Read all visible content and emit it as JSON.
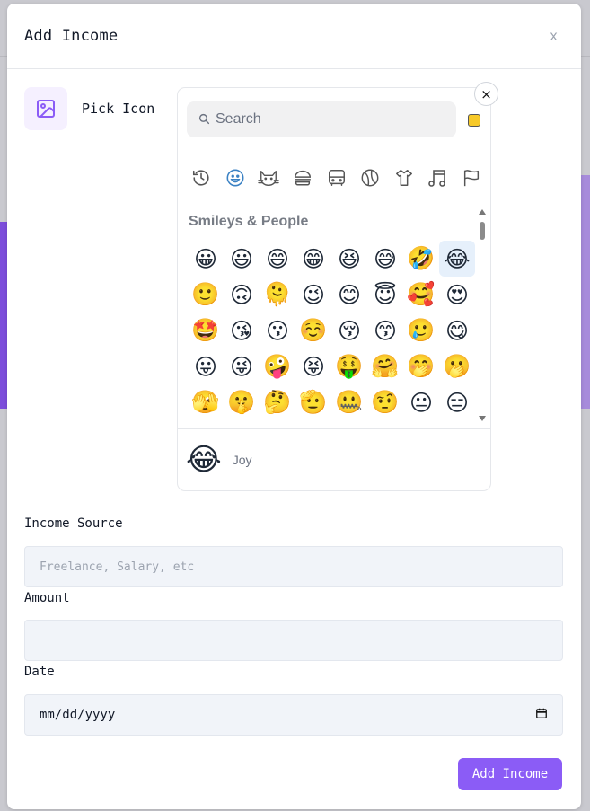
{
  "modal": {
    "title": "Add Income",
    "close_label": "x"
  },
  "pick_icon": {
    "label": "Pick Icon",
    "icon": "image-icon",
    "accent_color": "#8b5cf6"
  },
  "emoji_picker": {
    "close_label": "×",
    "search_placeholder": "Search",
    "skin_tone_color": "#f7c928",
    "categories": [
      "recent-icon",
      "smiley-icon",
      "cat-icon",
      "burger-icon",
      "bus-icon",
      "ball-icon",
      "shirt-icon",
      "music-icon",
      "flag-icon"
    ],
    "active_category": "smiley-icon",
    "section_title": "Smileys & People",
    "emojis": [
      "😀",
      "😃",
      "😄",
      "😁",
      "😆",
      "😅",
      "🤣",
      "😂",
      "🙂",
      "🙃",
      "🫠",
      "😉",
      "😊",
      "😇",
      "🥰",
      "😍",
      "🤩",
      "😘",
      "😗",
      "☺️",
      "😚",
      "😙",
      "🥲",
      "😋",
      "😛",
      "😜",
      "🤪",
      "😝",
      "🤑",
      "🤗",
      "🤭",
      "🫢",
      "🫣",
      "🤫",
      "🤔",
      "🫡",
      "🤐",
      "🤨",
      "😐",
      "😑",
      "😶",
      "🫥",
      "😏",
      "😒",
      "🙄",
      "😬",
      "😮‍💨",
      "🤥"
    ],
    "selected_emoji": "😂",
    "preview": {
      "emoji": "😂",
      "name": "Joy"
    }
  },
  "form": {
    "source_label": "Income Source",
    "source_placeholder": "Freelance, Salary, etc",
    "amount_label": "Amount",
    "amount_value": "",
    "date_label": "Date",
    "date_value": "mm/dd/yyyy",
    "submit_label": "Add Income"
  }
}
